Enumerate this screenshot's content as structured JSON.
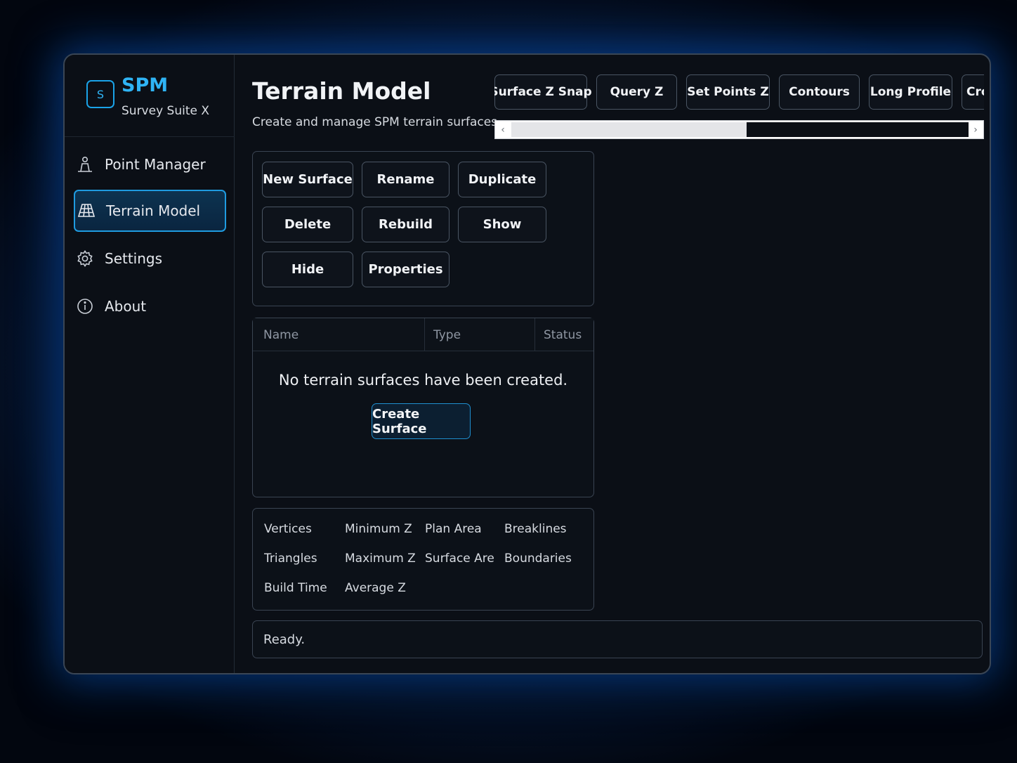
{
  "brand": {
    "logo_letter": "S",
    "name": "SPM",
    "subtitle": "Survey Suite X"
  },
  "sidebar": {
    "items": [
      {
        "label": "Point Manager",
        "icon": "surveyor-icon",
        "active": false
      },
      {
        "label": "Terrain Model",
        "icon": "grid-terrain-icon",
        "active": true
      },
      {
        "label": "Settings",
        "icon": "gear-icon",
        "active": false
      },
      {
        "label": "About",
        "icon": "info-icon",
        "active": false
      }
    ]
  },
  "header": {
    "title": "Terrain Model",
    "subtitle": "Create and manage SPM terrain surfaces"
  },
  "toolbar": {
    "buttons": [
      "Surface Z Snap",
      "Query Z",
      "Set Points Z",
      "Contours",
      "Long Profile",
      "Cro"
    ],
    "scroll_left": "‹",
    "scroll_right": "›"
  },
  "actions": {
    "buttons": [
      "New Surface",
      "Rename",
      "Duplicate",
      "Delete",
      "Rebuild",
      "Show",
      "Hide",
      "Properties"
    ]
  },
  "table": {
    "columns": [
      "Name",
      "Type",
      "Status"
    ],
    "empty_message": "No terrain surfaces have been created.",
    "create_label": "Create Surface"
  },
  "stats": {
    "labels": [
      "Vertices",
      "Minimum Z",
      "Plan Area",
      "Breaklines",
      "Triangles",
      "Maximum Z",
      "Surface Are",
      "Boundaries",
      "Build Time",
      "Average Z"
    ]
  },
  "status": {
    "text": "Ready."
  },
  "colors": {
    "accent": "#2fb4f5",
    "active_border": "#1f9be0",
    "panel_border": "#3a4452"
  }
}
